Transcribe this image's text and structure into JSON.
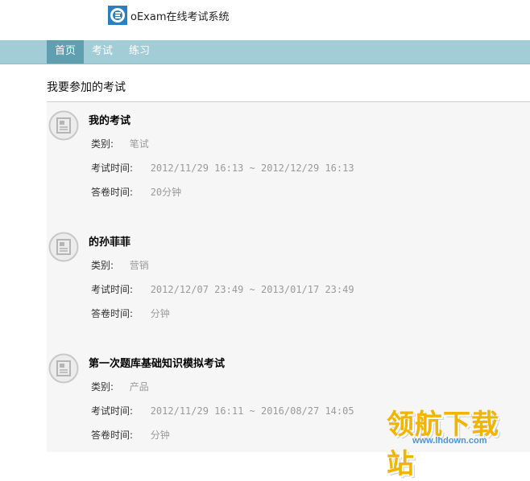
{
  "app": {
    "title": "oExam在线考试系统"
  },
  "nav": {
    "items": [
      {
        "label": "首页",
        "active": true
      },
      {
        "label": "考试",
        "active": false
      },
      {
        "label": "练习",
        "active": false
      }
    ]
  },
  "section": {
    "title": "我要参加的考试"
  },
  "exams": [
    {
      "title": "我的考试",
      "category_label": "类别:",
      "category": "笔试",
      "time_label": "考试时间:",
      "time": "2012/11/29 16:13 ~ 2012/12/29 16:13",
      "duration_label": "答卷时间:",
      "duration": "20分钟"
    },
    {
      "title": "的孙菲菲",
      "category_label": "类别:",
      "category": "营销",
      "time_label": "考试时间:",
      "time": "2012/12/07 23:49 ~ 2013/01/17 23:49",
      "duration_label": "答卷时间:",
      "duration": "分钟"
    },
    {
      "title": "第一次题库基础知识模拟考试",
      "category_label": "类别:",
      "category": "产品",
      "time_label": "考试时间:",
      "time": "2012/11/29 16:11 ~ 2016/08/27 14:05",
      "duration_label": "答卷时间:",
      "duration": "分钟"
    }
  ],
  "watermark": {
    "text": "领航下载站",
    "url": "www.lhdown.com"
  },
  "colors": {
    "nav_bg": "#a3cdd6",
    "nav_active": "#5f9fb0",
    "list_bg": "#f6f6f6"
  }
}
